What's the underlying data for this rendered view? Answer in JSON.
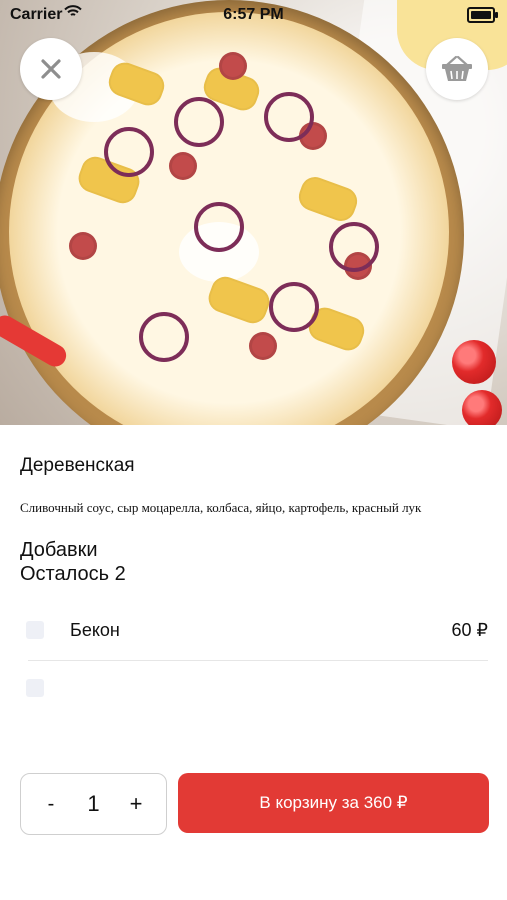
{
  "status_bar": {
    "carrier": "Carrier",
    "time": "6:57 PM",
    "battery_level": 1.0
  },
  "hero": {
    "image_alt": "pizza-photo"
  },
  "actions": {
    "close_icon": "close-icon",
    "basket_icon": "basket-icon"
  },
  "product": {
    "title": "Деревенская",
    "description": "Сливочный соус, сыр моцарелла, колбаса, яйцо, картофель, красный лук"
  },
  "addons": {
    "title": "Добавки",
    "remaining": "Осталось 2",
    "items": [
      {
        "label": "Бекон",
        "price": "60 ₽"
      },
      {
        "label": "",
        "price": ""
      }
    ]
  },
  "footer": {
    "minus_label": "-",
    "quantity": "1",
    "plus_label": "+",
    "cart_button_label": "В корзину за 360 ₽"
  },
  "colors": {
    "accent": "#e23a35",
    "text_primary": "#111111",
    "divider": "#e6e6e6"
  }
}
